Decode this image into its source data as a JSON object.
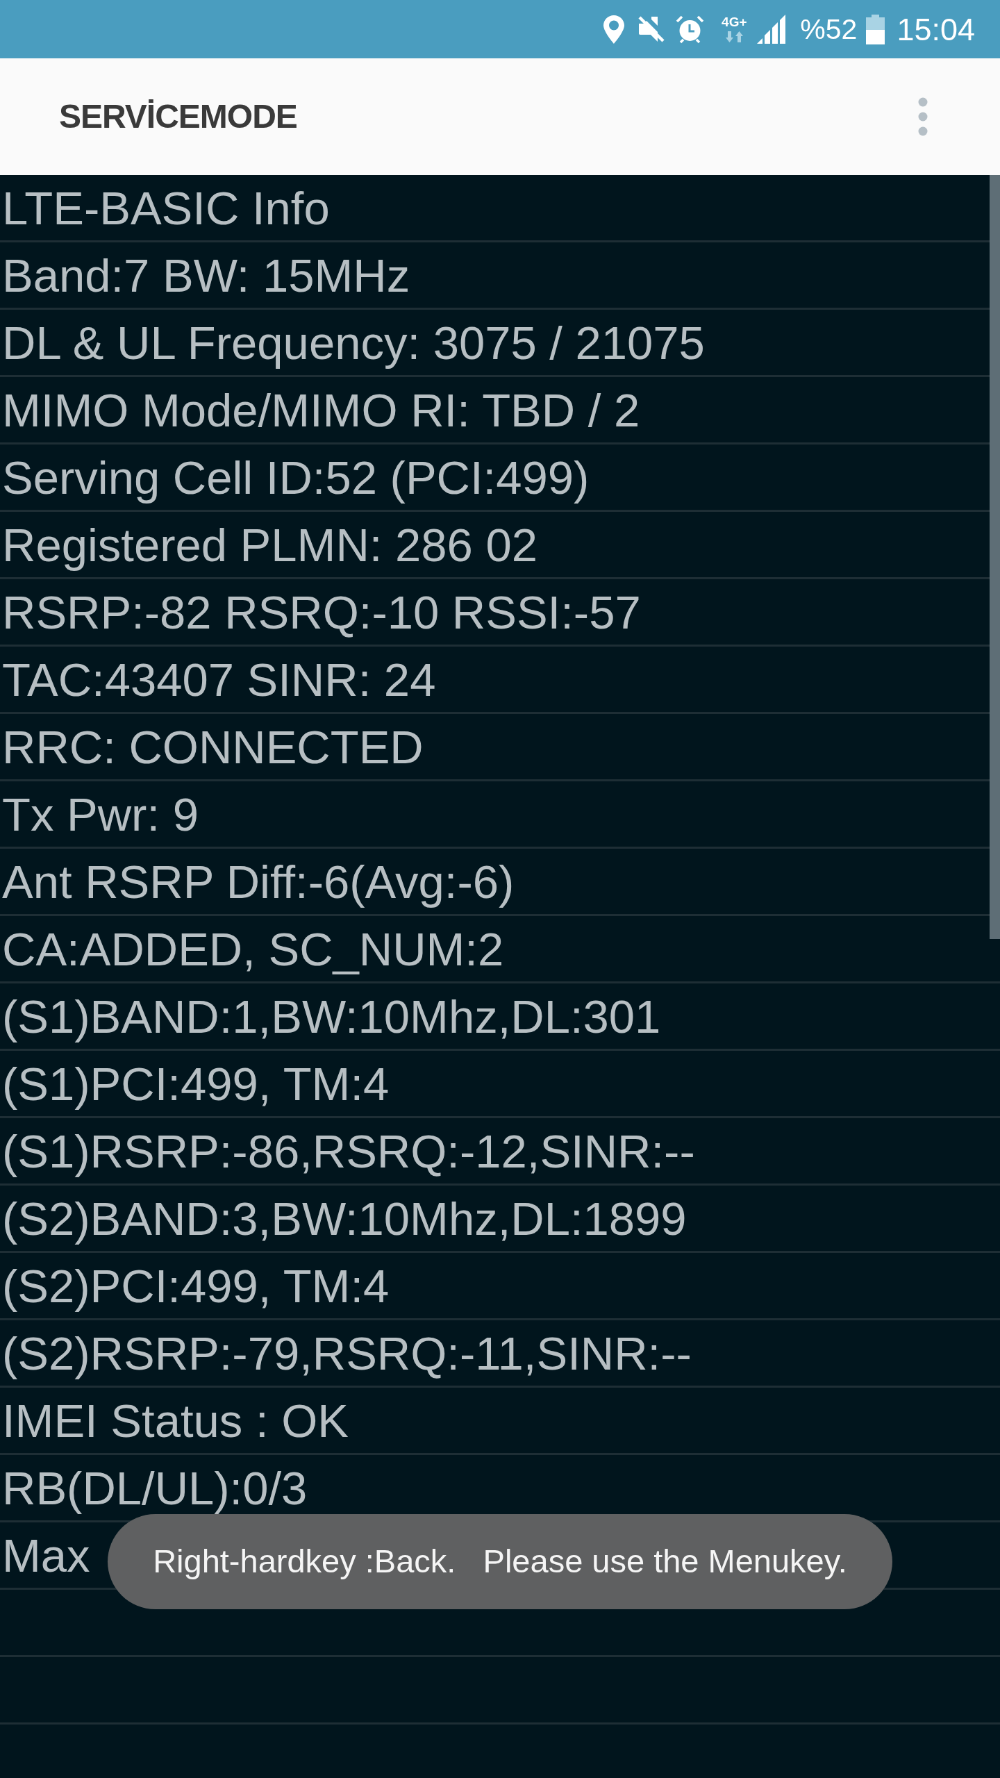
{
  "status_bar": {
    "network_type": "4G+",
    "battery_percent": "%52",
    "time": "15:04"
  },
  "app_bar": {
    "title": "SERVİCEMODE"
  },
  "rows": [
    "LTE-BASIC Info",
    "Band:7 BW: 15MHz",
    "DL & UL Frequency: 3075 / 21075",
    "MIMO Mode/MIMO RI: TBD / 2",
    "Serving Cell ID:52 (PCI:499)",
    "Registered PLMN: 286 02",
    "RSRP:-82 RSRQ:-10 RSSI:-57",
    "TAC:43407 SINR: 24",
    "RRC: CONNECTED",
    "Tx Pwr: 9",
    "Ant RSRP Diff:-6(Avg:-6)",
    "CA:ADDED, SC_NUM:2",
    "(S1)BAND:1,BW:10Mhz,DL:301",
    "(S1)PCI:499, TM:4",
    "(S1)RSRP:-86,RSRQ:-12,SINR:--",
    "(S2)BAND:3,BW:10Mhz,DL:1899",
    "(S2)PCI:499, TM:4",
    "(S2)RSRP:-79,RSRQ:-11,SINR:--",
    "IMEI Status : OK",
    "RB(DL/UL):0/3",
    "Max"
  ],
  "toast": {
    "text": "Right-hardkey :Back.   Please use the Menukey."
  }
}
